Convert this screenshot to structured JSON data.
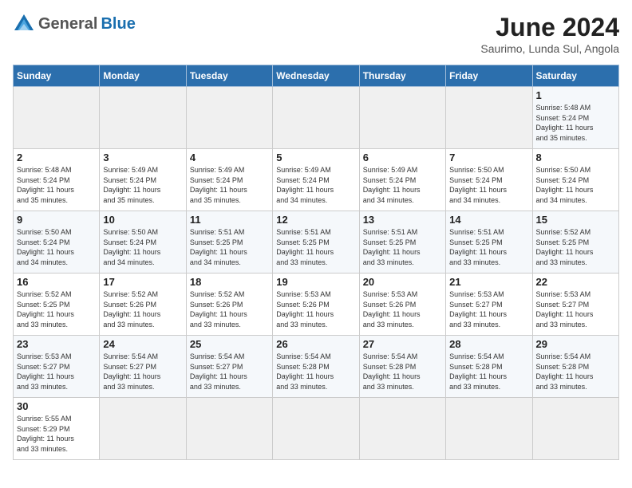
{
  "header": {
    "logo_general": "General",
    "logo_blue": "Blue",
    "month_title": "June 2024",
    "subtitle": "Saurimo, Lunda Sul, Angola"
  },
  "days_of_week": [
    "Sunday",
    "Monday",
    "Tuesday",
    "Wednesday",
    "Thursday",
    "Friday",
    "Saturday"
  ],
  "weeks": [
    [
      {
        "day": "",
        "info": ""
      },
      {
        "day": "",
        "info": ""
      },
      {
        "day": "",
        "info": ""
      },
      {
        "day": "",
        "info": ""
      },
      {
        "day": "",
        "info": ""
      },
      {
        "day": "",
        "info": ""
      },
      {
        "day": "1",
        "info": "Sunrise: 5:48 AM\nSunset: 5:24 PM\nDaylight: 11 hours\nand 35 minutes."
      }
    ],
    [
      {
        "day": "2",
        "info": "Sunrise: 5:48 AM\nSunset: 5:24 PM\nDaylight: 11 hours\nand 35 minutes."
      },
      {
        "day": "3",
        "info": "Sunrise: 5:49 AM\nSunset: 5:24 PM\nDaylight: 11 hours\nand 35 minutes."
      },
      {
        "day": "4",
        "info": "Sunrise: 5:49 AM\nSunset: 5:24 PM\nDaylight: 11 hours\nand 35 minutes."
      },
      {
        "day": "5",
        "info": "Sunrise: 5:49 AM\nSunset: 5:24 PM\nDaylight: 11 hours\nand 34 minutes."
      },
      {
        "day": "6",
        "info": "Sunrise: 5:49 AM\nSunset: 5:24 PM\nDaylight: 11 hours\nand 34 minutes."
      },
      {
        "day": "7",
        "info": "Sunrise: 5:50 AM\nSunset: 5:24 PM\nDaylight: 11 hours\nand 34 minutes."
      },
      {
        "day": "8",
        "info": "Sunrise: 5:50 AM\nSunset: 5:24 PM\nDaylight: 11 hours\nand 34 minutes."
      }
    ],
    [
      {
        "day": "9",
        "info": "Sunrise: 5:50 AM\nSunset: 5:24 PM\nDaylight: 11 hours\nand 34 minutes."
      },
      {
        "day": "10",
        "info": "Sunrise: 5:50 AM\nSunset: 5:24 PM\nDaylight: 11 hours\nand 34 minutes."
      },
      {
        "day": "11",
        "info": "Sunrise: 5:51 AM\nSunset: 5:25 PM\nDaylight: 11 hours\nand 34 minutes."
      },
      {
        "day": "12",
        "info": "Sunrise: 5:51 AM\nSunset: 5:25 PM\nDaylight: 11 hours\nand 33 minutes."
      },
      {
        "day": "13",
        "info": "Sunrise: 5:51 AM\nSunset: 5:25 PM\nDaylight: 11 hours\nand 33 minutes."
      },
      {
        "day": "14",
        "info": "Sunrise: 5:51 AM\nSunset: 5:25 PM\nDaylight: 11 hours\nand 33 minutes."
      },
      {
        "day": "15",
        "info": "Sunrise: 5:52 AM\nSunset: 5:25 PM\nDaylight: 11 hours\nand 33 minutes."
      }
    ],
    [
      {
        "day": "16",
        "info": "Sunrise: 5:52 AM\nSunset: 5:25 PM\nDaylight: 11 hours\nand 33 minutes."
      },
      {
        "day": "17",
        "info": "Sunrise: 5:52 AM\nSunset: 5:26 PM\nDaylight: 11 hours\nand 33 minutes."
      },
      {
        "day": "18",
        "info": "Sunrise: 5:52 AM\nSunset: 5:26 PM\nDaylight: 11 hours\nand 33 minutes."
      },
      {
        "day": "19",
        "info": "Sunrise: 5:53 AM\nSunset: 5:26 PM\nDaylight: 11 hours\nand 33 minutes."
      },
      {
        "day": "20",
        "info": "Sunrise: 5:53 AM\nSunset: 5:26 PM\nDaylight: 11 hours\nand 33 minutes."
      },
      {
        "day": "21",
        "info": "Sunrise: 5:53 AM\nSunset: 5:27 PM\nDaylight: 11 hours\nand 33 minutes."
      },
      {
        "day": "22",
        "info": "Sunrise: 5:53 AM\nSunset: 5:27 PM\nDaylight: 11 hours\nand 33 minutes."
      }
    ],
    [
      {
        "day": "23",
        "info": "Sunrise: 5:53 AM\nSunset: 5:27 PM\nDaylight: 11 hours\nand 33 minutes."
      },
      {
        "day": "24",
        "info": "Sunrise: 5:54 AM\nSunset: 5:27 PM\nDaylight: 11 hours\nand 33 minutes."
      },
      {
        "day": "25",
        "info": "Sunrise: 5:54 AM\nSunset: 5:27 PM\nDaylight: 11 hours\nand 33 minutes."
      },
      {
        "day": "26",
        "info": "Sunrise: 5:54 AM\nSunset: 5:28 PM\nDaylight: 11 hours\nand 33 minutes."
      },
      {
        "day": "27",
        "info": "Sunrise: 5:54 AM\nSunset: 5:28 PM\nDaylight: 11 hours\nand 33 minutes."
      },
      {
        "day": "28",
        "info": "Sunrise: 5:54 AM\nSunset: 5:28 PM\nDaylight: 11 hours\nand 33 minutes."
      },
      {
        "day": "29",
        "info": "Sunrise: 5:54 AM\nSunset: 5:28 PM\nDaylight: 11 hours\nand 33 minutes."
      }
    ],
    [
      {
        "day": "30",
        "info": "Sunrise: 5:55 AM\nSunset: 5:29 PM\nDaylight: 11 hours\nand 33 minutes."
      },
      {
        "day": "",
        "info": ""
      },
      {
        "day": "",
        "info": ""
      },
      {
        "day": "",
        "info": ""
      },
      {
        "day": "",
        "info": ""
      },
      {
        "day": "",
        "info": ""
      },
      {
        "day": "",
        "info": ""
      }
    ]
  ]
}
